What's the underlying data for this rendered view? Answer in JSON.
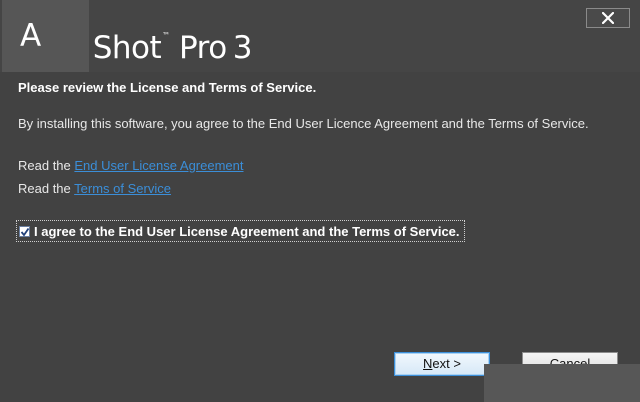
{
  "window": {
    "title_prefix": "A",
    "title_main": "Shot",
    "title_trademark": "™",
    "title_suffix": "Pro",
    "title_version": "3",
    "close_symbol": "✕"
  },
  "content": {
    "heading": "Please review the License and Terms of Service.",
    "intro": "By installing this software, you agree to the End User Licence Agreement and the Terms of Service.",
    "read_prefix": "Read the",
    "eula_link": "End User License Agreement",
    "tos_link": "Terms of Service",
    "agree_label": "I agree to the End User License Agreement and the Terms of Service.",
    "agree_checked": true
  },
  "buttons": {
    "next_mnemonic": "N",
    "next_rest": "ext >",
    "cancel": "Cancel"
  },
  "colors": {
    "background": "#424242",
    "link": "#3b8ed8",
    "accent_button_border": "#3c8fd9"
  }
}
